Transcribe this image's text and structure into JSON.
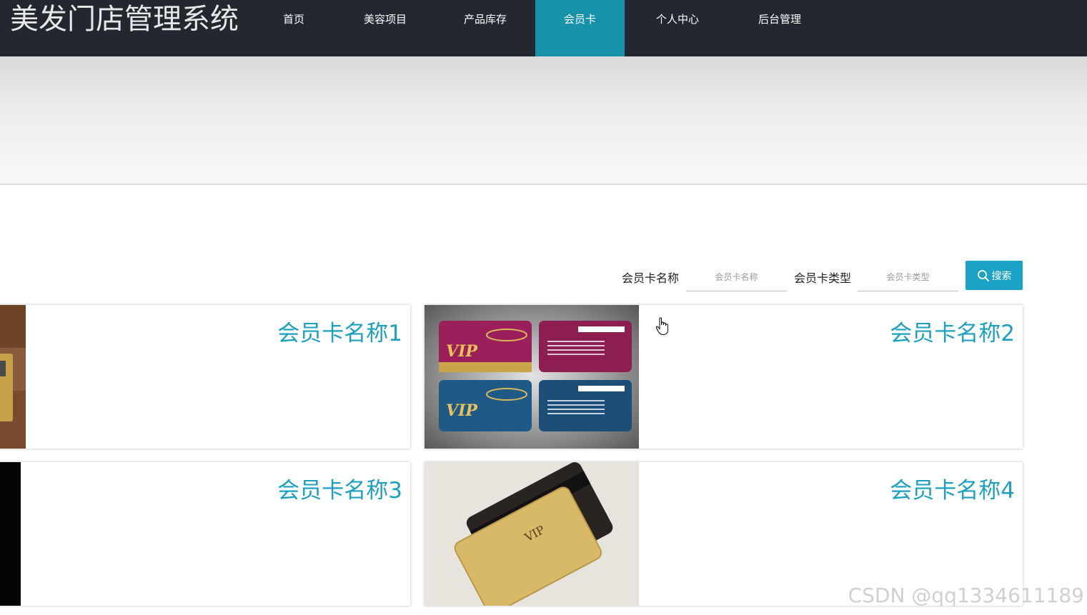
{
  "header": {
    "title": "美发门店管理系统",
    "nav": [
      {
        "label": "首页",
        "active": false
      },
      {
        "label": "美容项目",
        "active": false
      },
      {
        "label": "产品库存",
        "active": false
      },
      {
        "label": "会员卡",
        "active": true
      },
      {
        "label": "个人中心",
        "active": false
      },
      {
        "label": "后台管理",
        "active": false
      }
    ],
    "active_color": "#1892aa",
    "bar_color": "#23272f"
  },
  "search": {
    "name_label": "会员卡名称",
    "name_placeholder": "会员卡名称",
    "name_value": "",
    "type_label": "会员卡类型",
    "type_placeholder": "会员卡类型",
    "type_value": "",
    "button_label": "搜索",
    "button_icon": "search-icon",
    "button_color": "#1aa3c6"
  },
  "cards": [
    {
      "title": "会员卡名称1",
      "image": "vip-card-photo-wood"
    },
    {
      "title": "会员卡名称2",
      "image": "vip-card-set-red-blue"
    },
    {
      "title": "会员卡名称3",
      "image": "vip-card-photo-black"
    },
    {
      "title": "会员卡名称4",
      "image": "vip-card-gold"
    }
  ],
  "title_color": "#1ba0c0",
  "watermark": "CSDN @qq1334611189"
}
